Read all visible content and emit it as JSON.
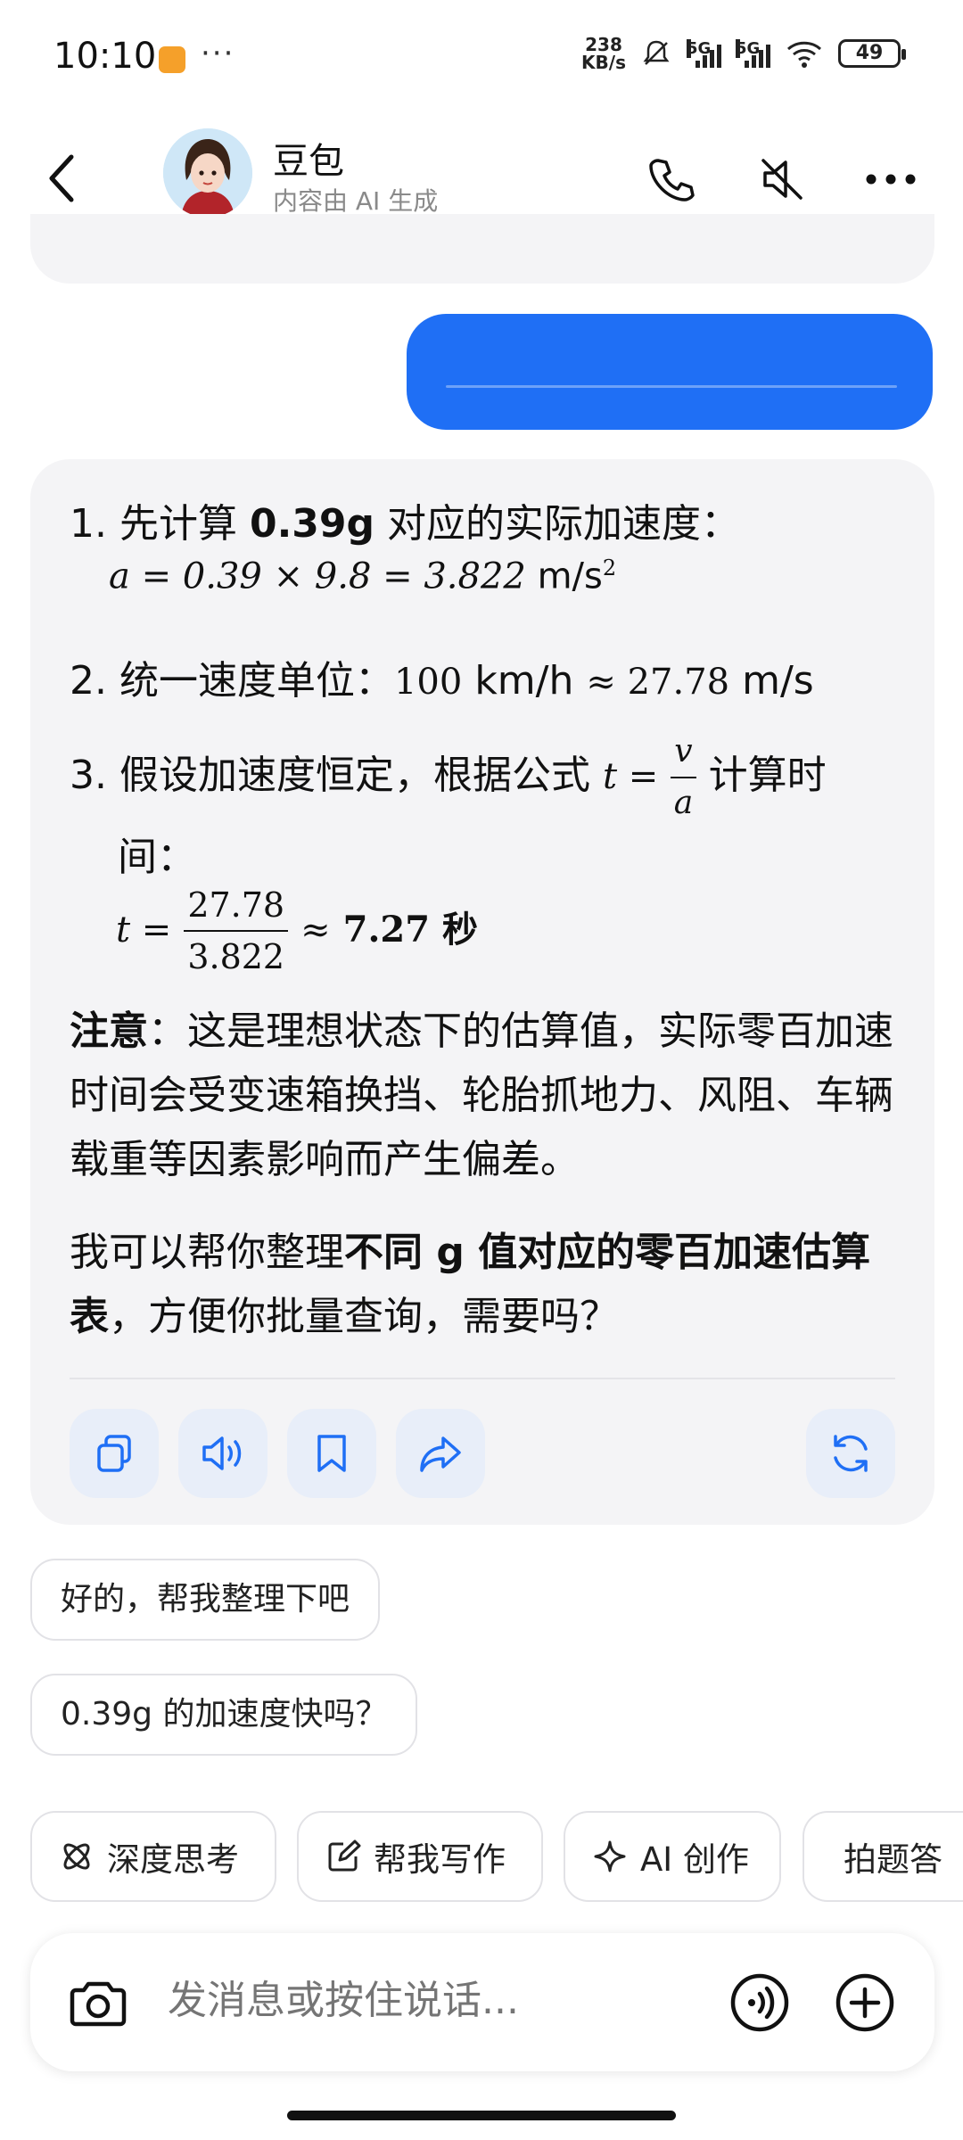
{
  "status_bar": {
    "time": "10:10",
    "more": "···",
    "net_speed_value": "238",
    "net_speed_unit": "KB/s",
    "sim1_label": "5G",
    "sim2_label": "5G",
    "battery": "49"
  },
  "header": {
    "name": "豆包",
    "subtitle": "内容由 AI 生成",
    "icons": [
      "back-icon",
      "phone-icon",
      "mute-icon",
      "more-icon"
    ]
  },
  "answer": {
    "step1_label": "1. 先计算 ",
    "step1_bold": "0.39g",
    "step1_rest": " 对应的实际加速度：",
    "step1_formula_lhs": "a = 0.39 × 9.8 = 3.822",
    "step1_unit": " m/s",
    "step1_exp": "2",
    "step2_label": "2. 统一速度单位：",
    "step2_value": "100",
    "step2_unit1": " km/h ",
    "step2_approx": "≈ 27.78",
    "step2_unit2": " m/s",
    "step3_label": "3. 假设加速度恒定，根据公式 ",
    "step3_formula_t": "t =",
    "step3_num": "v",
    "step3_den": "a",
    "step3_rest": " 计算时",
    "step3_wrap": "间：",
    "result_t": "t =",
    "result_num": "27.78",
    "result_den": "3.822",
    "result_approx": "≈",
    "result_value": "7.27 秒",
    "note_bold": "注意",
    "note_text": "：这是理想状态下的估算值，实际零百加速时间会受变速箱换挡、轮胎抓地力、风阻、车辆载重等因素影响而产生偏差。",
    "offer_pre": "我可以帮你整理",
    "offer_bold": "不同 g 值对应的零百加速估算表",
    "offer_post": "，方便你批量查询，需要吗？"
  },
  "actions": [
    "copy-icon",
    "speaker-icon",
    "bookmark-icon",
    "share-icon",
    "regenerate-icon"
  ],
  "suggestions": [
    "好的，帮我整理下吧",
    "0.39g 的加速度快吗？"
  ],
  "tools": [
    {
      "label": "深度思考",
      "icon": "atom-icon"
    },
    {
      "label": "帮我写作",
      "icon": "edit-icon"
    },
    {
      "label": "AI 创作",
      "icon": "sparkle-icon"
    },
    {
      "label": "拍题答",
      "icon": "scan-icon"
    }
  ],
  "input": {
    "placeholder": "发消息或按住说话..."
  },
  "colors": {
    "accent": "#1f6ff5",
    "card_bg": "#f4f4f6",
    "action_bg": "#e8eef9"
  }
}
